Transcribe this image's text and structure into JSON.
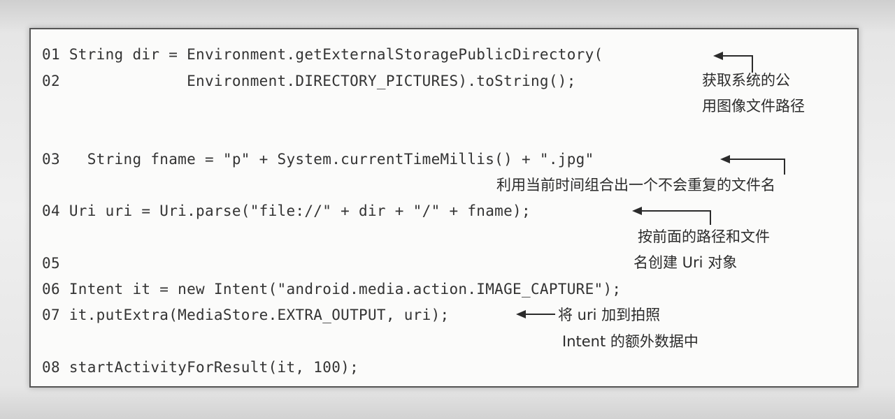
{
  "code_lines": [
    {
      "num": "01",
      "code": "String dir = Environment.getExternalStoragePublicDirectory("
    },
    {
      "num": "02",
      "code": "             Environment.DIRECTORY_PICTURES).toString();"
    },
    {
      "num": "03",
      "code": "  String fname = \"p\" + System.currentTimeMillis() + \".jpg\""
    },
    {
      "num": "04",
      "code": "Uri uri = Uri.parse(\"file://\" + dir + \"/\" + fname);"
    },
    {
      "num": "05",
      "code": ""
    },
    {
      "num": "06",
      "code": "Intent it = new Intent(\"android.media.action.IMAGE_CAPTURE\");"
    },
    {
      "num": "07",
      "code": "it.putExtra(MediaStore.EXTRA_OUTPUT, uri);"
    },
    {
      "num": "08",
      "code": "startActivityForResult(it, 100);"
    }
  ],
  "annotations": {
    "a1_line1": "获取系统的公",
    "a1_line2": "用图像文件路径",
    "a2": "利用当前时间组合出一个不会重复的文件名",
    "a3_line1": "按前面的路径和文件",
    "a3_line2": "名创建 Uri 对象",
    "a4_line1": "将 uri 加到拍照",
    "a4_line2": "Intent 的额外数据中"
  },
  "colors": {
    "text": "#333333",
    "border": "#555555",
    "panel": "#fbfbfa"
  }
}
